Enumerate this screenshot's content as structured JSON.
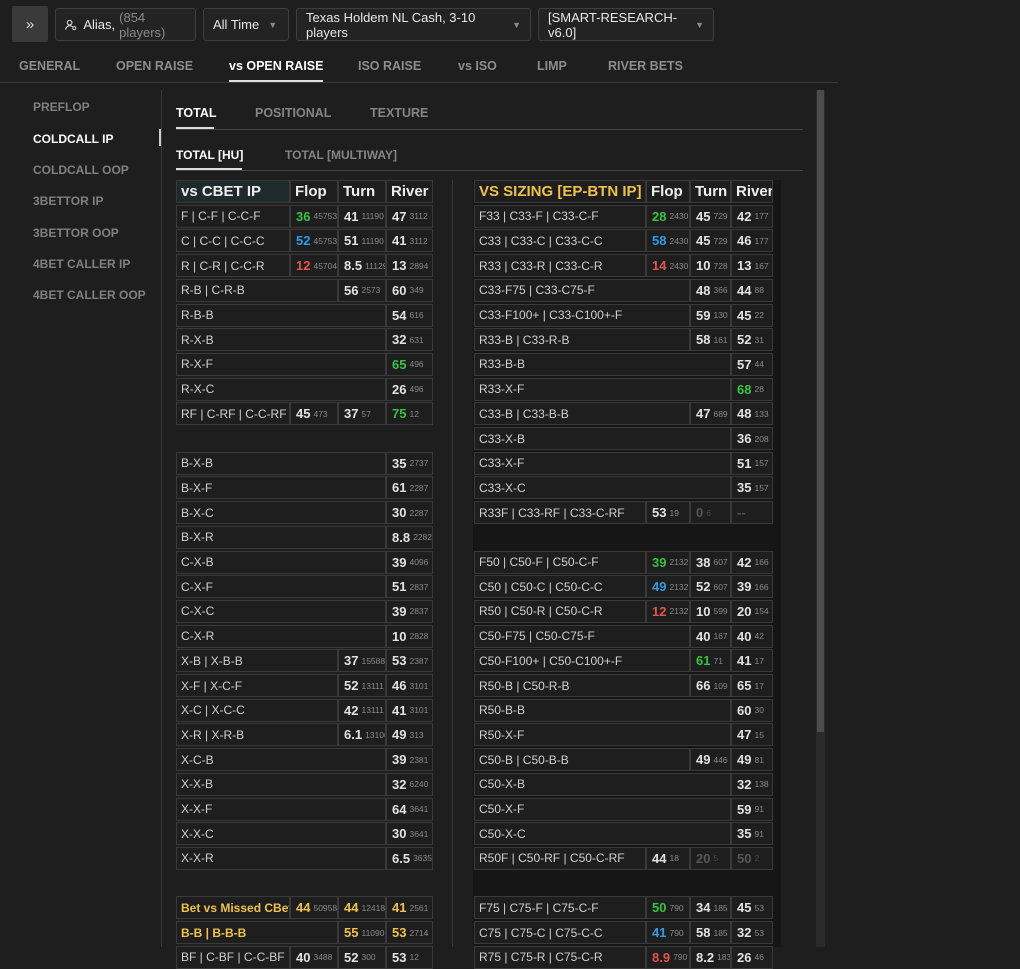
{
  "topbar": {
    "expand_icon": "»",
    "alias_label": "Alias,",
    "alias_count": "(854 players)",
    "time_label": "All Time",
    "game_label": "Texas Holdem NL Cash, 3-10 players",
    "profile_label": "[SMART-RESEARCH-v6.0]"
  },
  "tabs": [
    "GENERAL",
    "OPEN RAISE",
    "vs OPEN RAISE",
    "ISO RAISE",
    "vs ISO",
    "LIMP",
    "RIVER BETS"
  ],
  "active_tab": "vs OPEN RAISE",
  "sidebar": [
    "PREFLOP",
    "COLDCALL IP",
    "COLDCALL OOP",
    "3BETTOR IP",
    "3BETTOR OOP",
    "4BET CALLER IP",
    "4BET CALLER OOP"
  ],
  "active_sidebar": "COLDCALL IP",
  "subtabs": [
    "TOTAL",
    "POSITIONAL",
    "TEXTURE"
  ],
  "subtabs2": [
    "TOTAL [HU]",
    "TOTAL [MULTIWAY]"
  ],
  "colors": {
    "green": "#39c23f",
    "blue": "#2f9be6",
    "red": "#e5534b",
    "gold": "#f0c24b"
  },
  "left_table": {
    "header": [
      "vs CBET IP",
      "Flop",
      "Turn",
      "River"
    ],
    "rows": [
      {
        "label": "F | C-F | C-C-F",
        "flop": [
          "36",
          "45753",
          "green"
        ],
        "turn": [
          "41",
          "11190"
        ],
        "river": [
          "47",
          "3112"
        ]
      },
      {
        "label": "C | C-C | C-C-C",
        "flop": [
          "52",
          "45753",
          "blue"
        ],
        "turn": [
          "51",
          "11190"
        ],
        "river": [
          "41",
          "3112"
        ]
      },
      {
        "label": "R | C-R | C-C-R",
        "flop": [
          "12",
          "45704",
          "red"
        ],
        "turn": [
          "8.5",
          "11129"
        ],
        "river": [
          "13",
          "2894"
        ]
      },
      {
        "label": "R-B | C-R-B",
        "turn": [
          "56",
          "2573"
        ],
        "river": [
          "60",
          "349"
        ]
      },
      {
        "label": "R-B-B",
        "river": [
          "54",
          "616"
        ]
      },
      {
        "label": "R-X-B",
        "river": [
          "32",
          "631"
        ]
      },
      {
        "label": "R-X-F",
        "river": [
          "65",
          "496",
          "green"
        ]
      },
      {
        "label": "R-X-C",
        "river": [
          "26",
          "496"
        ]
      },
      {
        "label": "RF | C-RF | C-C-RF",
        "flop": [
          "45",
          "473"
        ],
        "turn": [
          "37",
          "57"
        ],
        "river": [
          "75",
          "12",
          "green"
        ]
      },
      {
        "gap": true
      },
      {
        "label": "B-X-B",
        "river": [
          "35",
          "2737"
        ]
      },
      {
        "label": "B-X-F",
        "river": [
          "61",
          "2287"
        ]
      },
      {
        "label": "B-X-C",
        "river": [
          "30",
          "2287"
        ]
      },
      {
        "label": "B-X-R",
        "river": [
          "8.8",
          "2282"
        ]
      },
      {
        "label": "C-X-B",
        "river": [
          "39",
          "4096"
        ]
      },
      {
        "label": "C-X-F",
        "river": [
          "51",
          "2837"
        ]
      },
      {
        "label": "C-X-C",
        "river": [
          "39",
          "2837"
        ]
      },
      {
        "label": "C-X-R",
        "river": [
          "10",
          "2828"
        ]
      },
      {
        "label": "X-B | X-B-B",
        "turn": [
          "37",
          "15588"
        ],
        "river": [
          "53",
          "2387"
        ]
      },
      {
        "label": "X-F | X-C-F",
        "turn": [
          "52",
          "13111"
        ],
        "river": [
          "46",
          "3101"
        ]
      },
      {
        "label": "X-C | X-C-C",
        "turn": [
          "42",
          "13111"
        ],
        "river": [
          "41",
          "3101"
        ]
      },
      {
        "label": "X-R | X-R-B",
        "turn": [
          "6.1",
          "13106"
        ],
        "river": [
          "49",
          "313"
        ]
      },
      {
        "label": "X-C-B",
        "river": [
          "39",
          "2381"
        ]
      },
      {
        "label": "X-X-B",
        "river": [
          "32",
          "6240"
        ]
      },
      {
        "label": "X-X-F",
        "river": [
          "64",
          "3641"
        ]
      },
      {
        "label": "X-X-C",
        "river": [
          "30",
          "3641"
        ]
      },
      {
        "label": "X-X-R",
        "river": [
          "6.5",
          "3635"
        ]
      },
      {
        "gap": true
      },
      {
        "label": "Bet vs Missed CBet",
        "gold": true,
        "flop": [
          "44",
          "50958",
          "gold"
        ],
        "turn": [
          "44",
          "12418",
          "gold"
        ],
        "river": [
          "41",
          "2561",
          "gold"
        ]
      },
      {
        "label": "B-B | B-B-B",
        "gold": true,
        "turn": [
          "55",
          "11090",
          "gold"
        ],
        "river": [
          "53",
          "2714",
          "gold"
        ]
      },
      {
        "label": "BF | C-BF | C-C-BF",
        "flop": [
          "40",
          "3488"
        ],
        "turn": [
          "52",
          "300"
        ],
        "river": [
          "53",
          "12"
        ]
      }
    ]
  },
  "right_table": {
    "header": [
      "VS SIZING [EP-BTN IP]",
      "Flop",
      "Turn",
      "River"
    ],
    "rows": [
      {
        "label": "F33 | C33-F | C33-C-F",
        "flop": [
          "28",
          "2430",
          "green"
        ],
        "turn": [
          "45",
          "729"
        ],
        "river": [
          "42",
          "177"
        ]
      },
      {
        "label": "C33 | C33-C | C33-C-C",
        "flop": [
          "58",
          "2430",
          "blue"
        ],
        "turn": [
          "45",
          "729"
        ],
        "river": [
          "46",
          "177"
        ]
      },
      {
        "label": "R33 | C33-R | C33-C-R",
        "flop": [
          "14",
          "2430",
          "red"
        ],
        "turn": [
          "10",
          "728"
        ],
        "river": [
          "13",
          "167"
        ]
      },
      {
        "label": "C33-F75 | C33-C75-F",
        "turn": [
          "48",
          "366"
        ],
        "river": [
          "44",
          "88"
        ]
      },
      {
        "label": "C33-F100+ | C33-C100+-F",
        "turn": [
          "59",
          "130"
        ],
        "river": [
          "45",
          "22"
        ]
      },
      {
        "label": "R33-B | C33-R-B",
        "turn": [
          "58",
          "161"
        ],
        "river": [
          "52",
          "31"
        ]
      },
      {
        "label": "R33-B-B",
        "river": [
          "57",
          "44"
        ]
      },
      {
        "label": "R33-X-F",
        "river": [
          "68",
          "28",
          "green"
        ]
      },
      {
        "label": "C33-B | C33-B-B",
        "turn": [
          "47",
          "689"
        ],
        "river": [
          "48",
          "133"
        ]
      },
      {
        "label": "C33-X-B",
        "river": [
          "36",
          "208"
        ]
      },
      {
        "label": "C33-X-F",
        "river": [
          "51",
          "157"
        ]
      },
      {
        "label": "C33-X-C",
        "river": [
          "35",
          "157"
        ]
      },
      {
        "label": "R33F | C33-RF | C33-C-RF",
        "flop": [
          "53",
          "19"
        ],
        "turn": [
          "0",
          "6",
          "dim"
        ],
        "river": [
          "--",
          "",
          "dim"
        ]
      },
      {
        "gap": true
      },
      {
        "label": "F50 | C50-F | C50-C-F",
        "flop": [
          "39",
          "2132",
          "green"
        ],
        "turn": [
          "38",
          "607"
        ],
        "river": [
          "42",
          "166"
        ]
      },
      {
        "label": "C50 | C50-C | C50-C-C",
        "flop": [
          "49",
          "2132",
          "blue"
        ],
        "turn": [
          "52",
          "607"
        ],
        "river": [
          "39",
          "166"
        ]
      },
      {
        "label": "R50 | C50-R | C50-C-R",
        "flop": [
          "12",
          "2132",
          "red"
        ],
        "turn": [
          "10",
          "599"
        ],
        "river": [
          "20",
          "154"
        ]
      },
      {
        "label": "C50-F75 | C50-C75-F",
        "turn": [
          "40",
          "167"
        ],
        "river": [
          "40",
          "42"
        ]
      },
      {
        "label": "C50-F100+ | C50-C100+-F",
        "turn": [
          "61",
          "71",
          "green"
        ],
        "river": [
          "41",
          "17"
        ]
      },
      {
        "label": "R50-B | C50-R-B",
        "turn": [
          "66",
          "109"
        ],
        "river": [
          "65",
          "17"
        ]
      },
      {
        "label": "R50-B-B",
        "river": [
          "60",
          "30"
        ]
      },
      {
        "label": "R50-X-F",
        "river": [
          "47",
          "15"
        ]
      },
      {
        "label": "C50-B | C50-B-B",
        "turn": [
          "49",
          "446"
        ],
        "river": [
          "49",
          "81"
        ]
      },
      {
        "label": "C50-X-B",
        "river": [
          "32",
          "138"
        ]
      },
      {
        "label": "C50-X-F",
        "river": [
          "59",
          "91"
        ]
      },
      {
        "label": "C50-X-C",
        "river": [
          "35",
          "91"
        ]
      },
      {
        "label": "R50F | C50-RF | C50-C-RF",
        "flop": [
          "44",
          "18"
        ],
        "turn": [
          "20",
          "5",
          "dim"
        ],
        "river": [
          "50",
          "2",
          "dim"
        ]
      },
      {
        "gap": true
      },
      {
        "label": "F75 | C75-F | C75-C-F",
        "flop": [
          "50",
          "790",
          "green"
        ],
        "turn": [
          "34",
          "185"
        ],
        "river": [
          "45",
          "53"
        ]
      },
      {
        "label": "C75 | C75-C | C75-C-C",
        "flop": [
          "41",
          "790",
          "blue"
        ],
        "turn": [
          "58",
          "185"
        ],
        "river": [
          "32",
          "53"
        ]
      },
      {
        "label": "R75 | C75-R | C75-C-R",
        "flop": [
          "8.9",
          "790",
          "red"
        ],
        "turn": [
          "8.2",
          "183"
        ],
        "river": [
          "26",
          "46"
        ]
      }
    ]
  }
}
